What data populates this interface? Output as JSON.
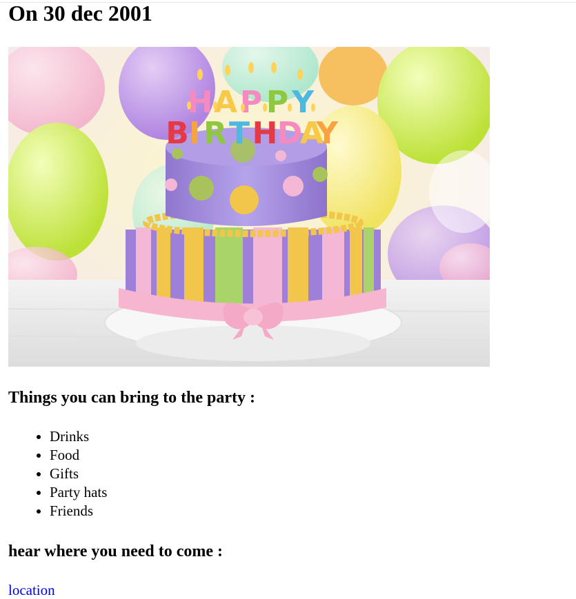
{
  "heading": "On 30 dec 2001",
  "image": {
    "candle_letters_top": [
      "H",
      "A",
      "P",
      "P",
      "Y"
    ],
    "candle_letters_bottom": [
      "B",
      "I",
      "R",
      "T",
      "H",
      "D",
      "A",
      "Y"
    ],
    "colors": {
      "top_tier": "#9b87d6",
      "bottom_tier": "#9f7bd4",
      "ribbon": "#f6b6cf",
      "stripe_yellow": "#f2c64a",
      "stripe_green": "#a8d46a",
      "plate": "#ffffff",
      "table": "#e8e8e8"
    }
  },
  "bring_section": {
    "title": "Things you can bring to the party :",
    "items": [
      {
        "label": "Drinks"
      },
      {
        "label": "Food"
      },
      {
        "label": "Gifts"
      },
      {
        "label": "Party hats"
      },
      {
        "label": "Friends"
      }
    ]
  },
  "where_section": {
    "title": "hear where you need to come :",
    "link_text": "location"
  }
}
